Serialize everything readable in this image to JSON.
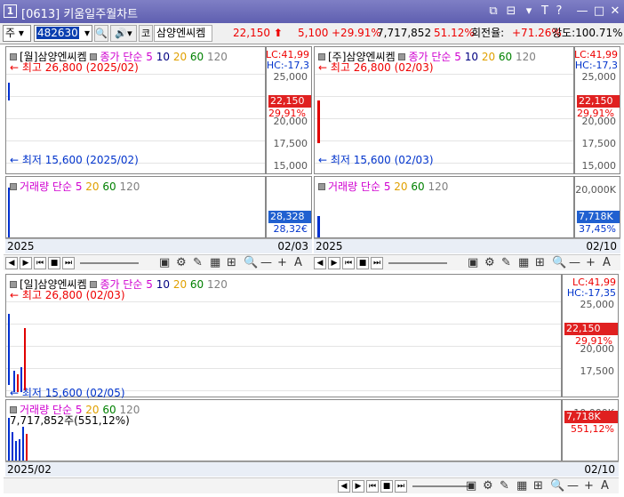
{
  "window": {
    "num": "1",
    "title": "[0613] 키움일주월차트",
    "controls": [
      "⧉",
      "⊟",
      "▾",
      "T",
      "?",
      "—",
      "□",
      "✕"
    ]
  },
  "toolbar": {
    "market": "주",
    "code": "482630",
    "type": "코",
    "name": "삼양엔씨켐",
    "price": "22,150",
    "change": "5,100",
    "rate": "+29.91%",
    "volume": "7,717,852",
    "vol_rate": "51.12%",
    "turnover_label": "회전율:",
    "turnover": "+71.26%",
    "strength": "강도:100.71%"
  },
  "charts": [
    {
      "id": "monthly-top",
      "header": "[월]삼양엔씨켐",
      "price_label": "종가 단순 5",
      "mas": [
        "10",
        "20",
        "60",
        "120"
      ],
      "high": "최고 26,800 (2025/02)",
      "low": "최저 15,600 (2025/02)",
      "lc": "LC:41,99",
      "hc": "HC:-17,3",
      "ticks": [
        "25,000",
        "22,500",
        "20,000",
        "17,500",
        "15,000"
      ],
      "price_tag": "22,150",
      "rate_tag": "29,91%",
      "vol_label": "거래량 단순 5",
      "vol_mas": [
        "20",
        "60",
        "120"
      ],
      "vol_tag": "28,328",
      "vol_tag2": "28,32€",
      "footer_left": "2025",
      "footer_right": "02/03"
    },
    {
      "id": "weekly-top",
      "header": "[주]삼양엔씨켐",
      "price_label": "종가 단순 5",
      "mas": [
        "10",
        "20",
        "60",
        "120"
      ],
      "high": "최고 26,800 (02/03)",
      "low": "최저 15,600 (02/03)",
      "lc": "LC:41,99",
      "hc": "HC:-17,3",
      "ticks": [
        "25,000",
        "22,500",
        "20,000",
        "17,500",
        "15,000"
      ],
      "price_tag": "22,150",
      "rate_tag": "29,91%",
      "vol_label": "거래량 단순 5",
      "vol_mas": [
        "20",
        "60",
        "120"
      ],
      "vol_ticks": [
        "20,000K"
      ],
      "vol_tag": "7,718K",
      "vol_tag2": "37,45%",
      "footer_left": "2025",
      "footer_right": "02/10"
    },
    {
      "id": "daily-bottom",
      "header": "[일]삼양엔씨켐",
      "price_label": "종가 단순 5",
      "mas": [
        "10",
        "20",
        "60",
        "120"
      ],
      "high": "최고 26,800 (02/03)",
      "low": "최저 15,600 (02/05)",
      "lc": "LC:41,99",
      "hc": "HC:-17,35",
      "ticks": [
        "25,000",
        "22,500",
        "20,000",
        "17,500"
      ],
      "price_tag": "22,150",
      "rate_tag": "29,91%",
      "vol_label": "거래량 단순 5",
      "vol_mas": [
        "20",
        "60",
        "120"
      ],
      "vol_value": "7,717,852주(551,12%)",
      "vol_ticks": [
        "10,000K"
      ],
      "vol_tag": "7,718K",
      "vol_tag2": "551,12%",
      "footer_left": "2025/02",
      "footer_right": "02/10"
    }
  ],
  "colors": {
    "ma5": "#d000d0",
    "ma10": "#000080",
    "ma20": "#e0a000",
    "ma60": "#008000",
    "ma120": "#808080",
    "up": "#e00000",
    "down": "#0030d0",
    "tag_red": "#e02020",
    "tag_blue": "#2060d0"
  }
}
